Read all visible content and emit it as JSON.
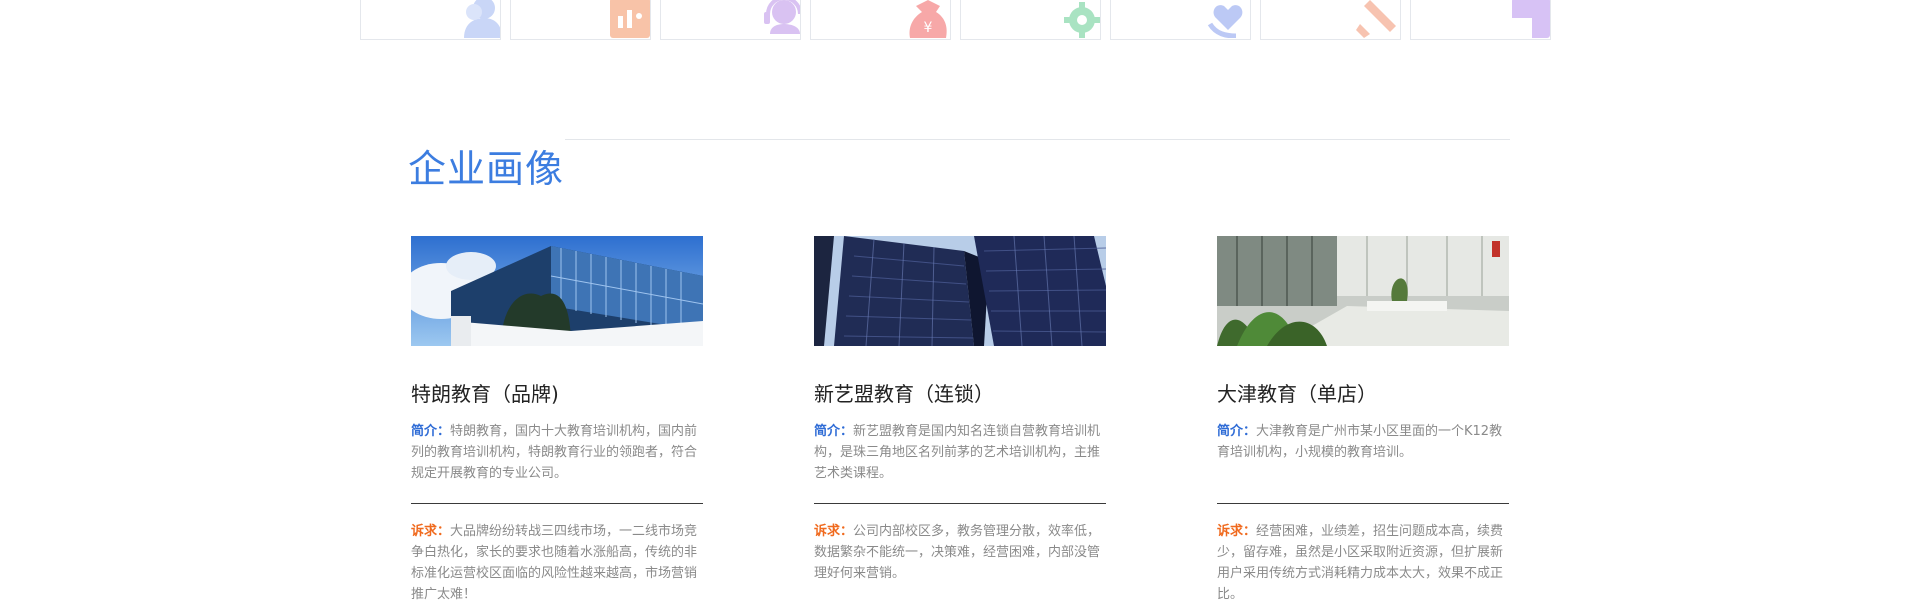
{
  "tiles": [
    {
      "icon": "user-group-icon",
      "color": "#c9d6f7"
    },
    {
      "icon": "chart-bars-icon",
      "color": "#f8c3a8"
    },
    {
      "icon": "headset-icon",
      "color": "#d9c2f2"
    },
    {
      "icon": "money-bag-yen-icon",
      "color": "#f7a8a8"
    },
    {
      "icon": "gear-icon",
      "color": "#a9e3c2"
    },
    {
      "icon": "heart-hand-icon",
      "color": "#bcc9f5"
    },
    {
      "icon": "brush-icon",
      "color": "#f7c3b0"
    },
    {
      "icon": "document-corner-icon",
      "color": "#d7c2f5"
    }
  ],
  "section": {
    "title": "企业画像"
  },
  "cards": [
    {
      "title": "特朗教育（品牌)",
      "intro_label": "简介：",
      "intro_text": "特朗教育，国内十大教育培训机构，国内前列的教育培训机构，特朗教育行业的领跑者，符合规定开展教育的专业公司。",
      "demand_label": "诉求：",
      "demand_text": "大品牌纷纷转战三四线市场，一二线市场竞争白热化，家长的要求也随着水涨船高，传统的非标准化运营校区面临的风险性越来越高，市场营销推广太难！"
    },
    {
      "title": "新艺盟教育（连锁）",
      "intro_label": "简介：",
      "intro_text": "新艺盟教育是国内知名连锁自营教育培训机构，是珠三角地区名列前茅的艺术培训机构，主推艺术类课程。",
      "demand_label": "诉求：",
      "demand_text": "公司内部校区多，教务管理分散，效率低，数据繁杂不能统一，决策难，经营困难，内部没管理好何来营销。"
    },
    {
      "title": "大津教育（单店）",
      "intro_label": "简介：",
      "intro_text": "大津教育是广州市某小区里面的一个K12教育培训机构，小规模的教育培训。",
      "demand_label": "诉求：",
      "demand_text": "经营困难，业绩差，招生问题成本高，续费少，留存难，虽然是小区采取附近资源，但扩展新用户采用传统方式消耗精力成本太大，效果不成正比。"
    }
  ]
}
